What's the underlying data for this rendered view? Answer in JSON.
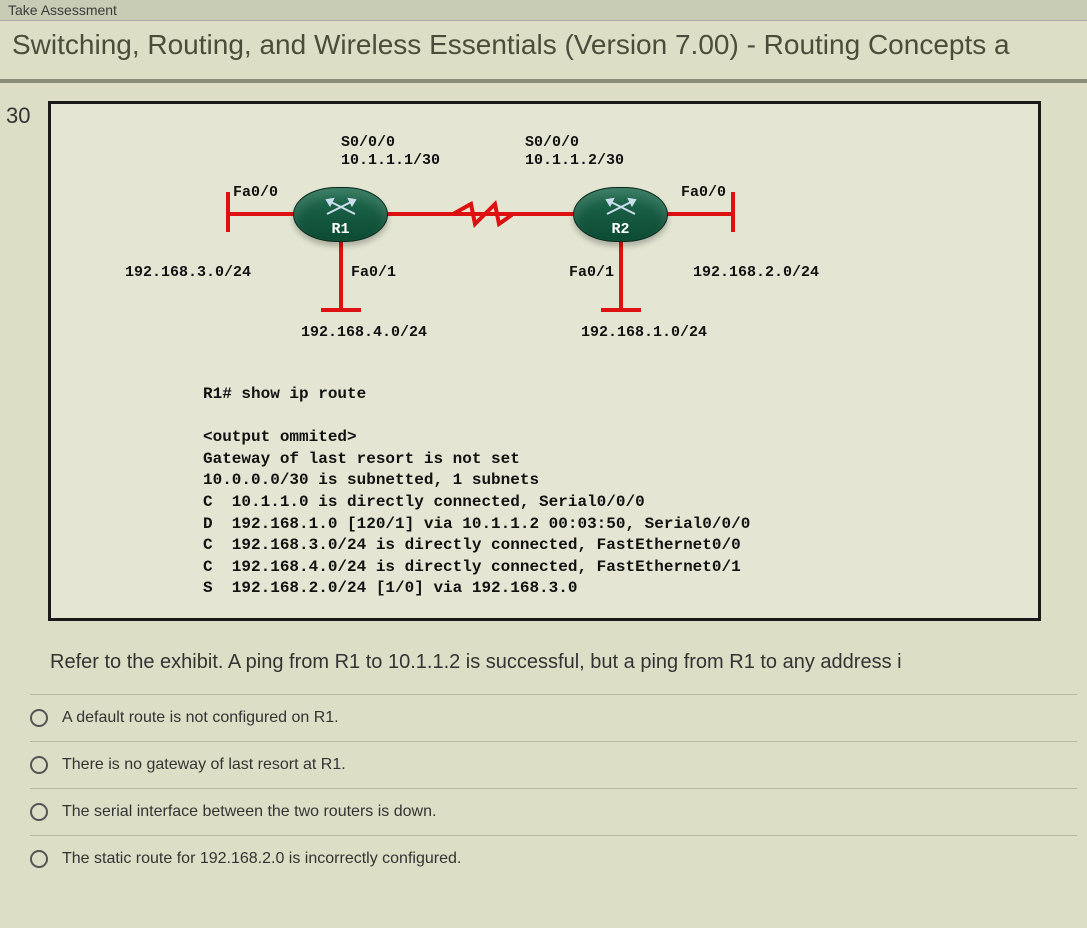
{
  "header": {
    "breadcrumb": "Take Assessment",
    "title": "Switching, Routing, and Wireless Essentials (Version 7.00) - Routing Concepts a"
  },
  "question": {
    "number": "30",
    "stem": "Refer to the exhibit. A ping from R1 to 10.1.1.2 is successful, but a ping from R1 to any address i"
  },
  "diagram": {
    "r1_name": "R1",
    "r2_name": "R2",
    "r1_s0": "S0/0/0",
    "r1_s0_ip": "10.1.1.1/30",
    "r2_s0": "S0/0/0",
    "r2_s0_ip": "10.1.1.2/30",
    "r1_fa00": "Fa0/0",
    "r2_fa00": "Fa0/0",
    "r1_fa01": "Fa0/1",
    "r2_fa01": "Fa0/1",
    "net_left": "192.168.3.0/24",
    "net_right": "192.168.2.0/24",
    "net_r1_down": "192.168.4.0/24",
    "net_r2_down": "192.168.1.0/24"
  },
  "cli": {
    "prompt": "R1# show ip route",
    "blank": "",
    "l1": "<output ommited>",
    "l2": "Gateway of last resort is not set",
    "l3": "10.0.0.0/30 is subnetted, 1 subnets",
    "l4": "C  10.1.1.0 is directly connected, Serial0/0/0",
    "l5": "D  192.168.1.0 [120/1] via 10.1.1.2 00:03:50, Serial0/0/0",
    "l6": "C  192.168.3.0/24 is directly connected, FastEthernet0/0",
    "l7": "C  192.168.4.0/24 is directly connected, FastEthernet0/1",
    "l8": "S  192.168.2.0/24 [1/0] via 192.168.3.0"
  },
  "options": {
    "a": "A default route is not configured on R1.",
    "b": "There is no gateway of last resort at R1.",
    "c": "The serial interface between the two routers is down.",
    "d": "The static route for 192.168.2.0 is incorrectly configured."
  }
}
